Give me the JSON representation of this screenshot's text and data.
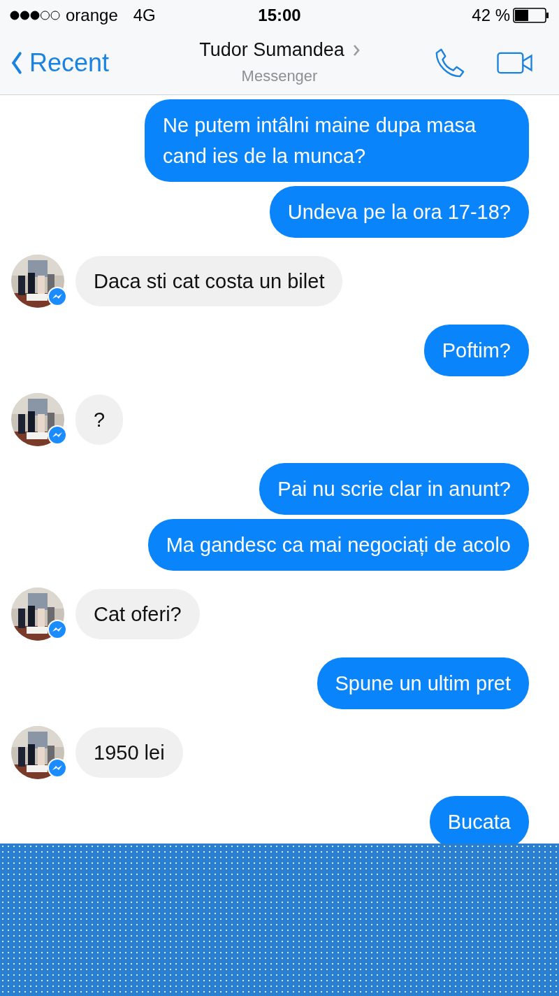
{
  "status_bar": {
    "carrier": "orange",
    "network": "4G",
    "time": "15:00",
    "battery": "42 %"
  },
  "header": {
    "back": "Recent",
    "title": "Tudor Sumandea",
    "subtitle": "Messenger"
  },
  "messages": [
    {
      "kind": "outgoing",
      "text": "Ne putem intâlni maine dupa masa cand ies de la munca?"
    },
    {
      "kind": "outgoing",
      "text": "Undeva pe la ora 17-18?"
    },
    {
      "kind": "incoming",
      "text": "Daca sti cat costa un bilet"
    },
    {
      "kind": "outgoing",
      "text": "Poftim?"
    },
    {
      "kind": "incoming",
      "text": "?"
    },
    {
      "kind": "outgoing",
      "text": "Pai nu scrie clar in anunt?"
    },
    {
      "kind": "outgoing",
      "text": "Ma gandesc ca mai negociați de acolo"
    },
    {
      "kind": "incoming",
      "text": "Cat oferi?"
    },
    {
      "kind": "outgoing",
      "text": "Spune un ultim pret"
    },
    {
      "kind": "incoming",
      "text": "1950 lei"
    },
    {
      "kind": "outgoing",
      "text": "Bucata"
    }
  ]
}
